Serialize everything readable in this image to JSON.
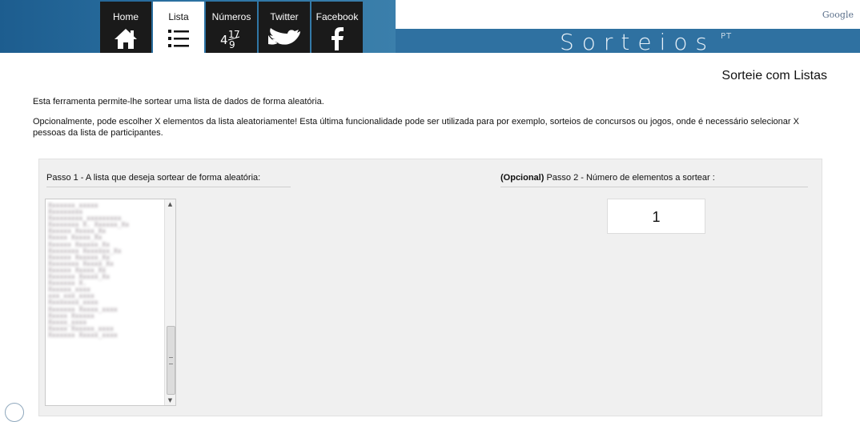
{
  "nav": {
    "tabs": [
      {
        "label": "Home",
        "icon": "home-icon"
      },
      {
        "label": "Lista",
        "icon": "list-icon"
      },
      {
        "label": "Números",
        "icon": "numbers-icon"
      },
      {
        "label": "Twitter",
        "icon": "twitter-bird-icon"
      },
      {
        "label": "Facebook",
        "icon": "facebook-icon"
      }
    ],
    "active_tab": "Lista"
  },
  "header": {
    "google": "Google",
    "brand": "Sorteios",
    "brand_suffix": "PT"
  },
  "page": {
    "title": "Sorteie com Listas",
    "intro": "Esta ferramenta permite-lhe sortear uma lista de dados de forma aleatória.",
    "optional_note": "Opcionalmente, pode escolher X elementos da lista aleatoriamente! Esta última funcionalidade pode ser utilizada para por exemplo, sorteios de concursos ou jogos, onde é necessário selecionar X pessoas da lista de participantes."
  },
  "step1": {
    "label": "Passo 1 - A lista que deseja sortear de forma aleatória:"
  },
  "step2": {
    "optional": "(Opcional)",
    "label": " Passo 2 - Número de elementos a sortear :",
    "value": "1"
  },
  "list_items": [
    "Xxxxxxx_xxxxx",
    "Xxxxxxxxx",
    "Xxxxxxxxx_xxxxxxxxx",
    "Xxxxxxxx X. Xxxxxx_Xx",
    "Xxxxxx Xxxxx_Xx",
    "Xxxxx Xxxxx_Xx",
    "Xxxxxx Xxxxxx_Xx",
    "Xxxxxxxx Xxxxxxx_Xx",
    "Xxxxxx Xxxxxx_Xx",
    "Xxxxxxxx Xxxxx_Xx",
    "Xxxxxx Xxxxx_Xx",
    "Xxxxxxx Xxxxx_Xx",
    "Xxxxxxx X.",
    "Xxxxxx_xxxx",
    "xxx_xxx_xxxx",
    "Xxxxxxxx_xxxx",
    "Xxxxxxx Xxxxx_xxxx",
    "Xxxxx Xxxxxx",
    "Xxxxx_xxxx",
    "Xxxxx Xxxxxx_xxxx",
    "Xxxxxxx Xxxxx_xxxx"
  ]
}
